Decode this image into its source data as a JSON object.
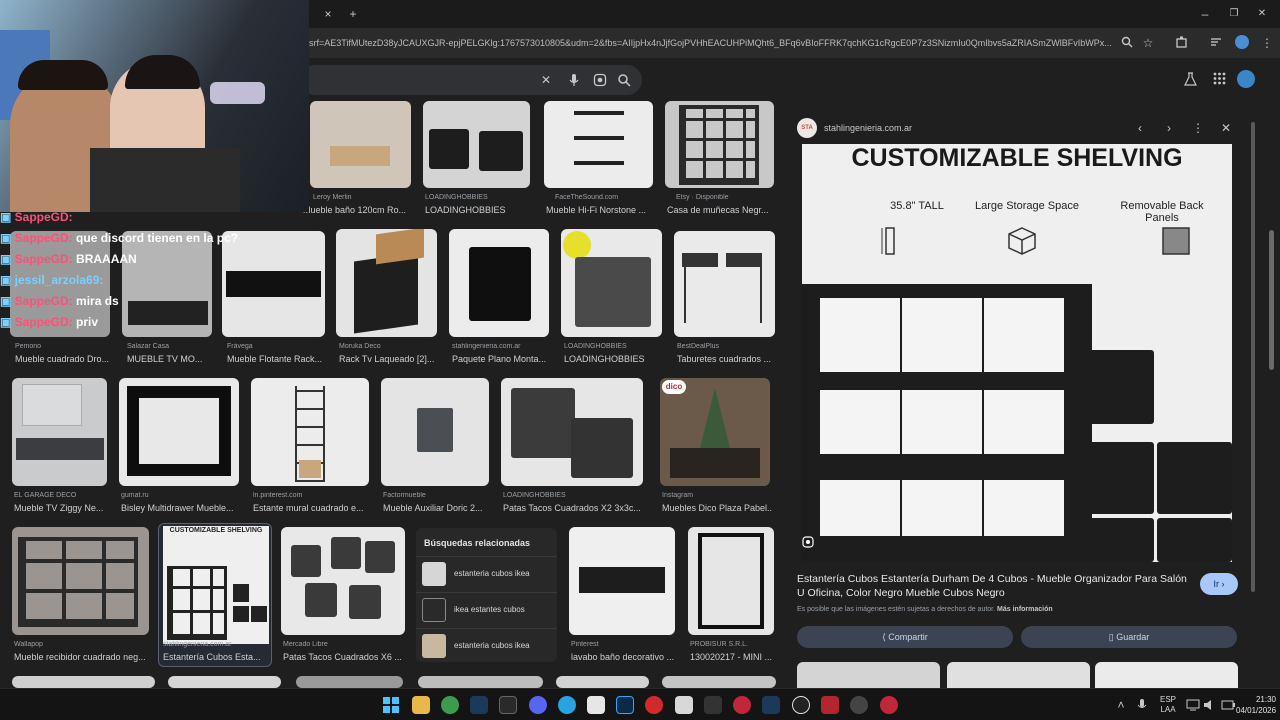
{
  "browser": {
    "url": "sxsrf=AE3TifMUtezD38yJCAUXGJR-epjPELGKlg:1767573010805&udm=2&fbs=AIIjpHx4nJjfGojPVHhEACUHPiMQht6_BFq6vBIoFFRK7qchKG1cRgcE0P7z3SNizmIu0QmIbvs5aZRIASmZWlBFvIbWPx...",
    "tab_close": "×",
    "new_tab": "+",
    "min": "–",
    "max": "❐",
    "close": "✕"
  },
  "search": {
    "clear": "✕"
  },
  "grid": {
    "row1": [
      {
        "src": "Leroy Merlin",
        "title": "Mueble baño 120cm Ro..."
      },
      {
        "src": "LOADINGHOBBIES",
        "title": "LOADINGHOBBIES"
      },
      {
        "src": "FaceTheSound.com",
        "title": "Mueble Hi-Fi Norstone ..."
      },
      {
        "src": "Etsy · Disponible",
        "title": "Casa de muñecas Negr..."
      }
    ],
    "row2": [
      {
        "src": "Pemono",
        "title": "Mueble cuadrado Dro..."
      },
      {
        "src": "Salazar Casa",
        "title": "MUEBLE TV MO..."
      },
      {
        "src": "Frávega",
        "title": "Mueble Flotante Rack..."
      },
      {
        "src": "Moruka Deco",
        "title": "Rack Tv Laqueado [2]..."
      },
      {
        "src": "stahlingenieria.com.ar",
        "title": "Paquete Plano Monta..."
      },
      {
        "src": "LOADINGHOBBIES",
        "title": "LOADINGHOBBIES"
      },
      {
        "src": "BestDealPlus",
        "title": "Taburetes cuadrados ..."
      }
    ],
    "row3": [
      {
        "src": "EL GARAGE DECO",
        "title": "Mueble TV Ziggy Ne..."
      },
      {
        "src": "gumat.ru",
        "title": "Bisley Multidrawer Mueble..."
      },
      {
        "src": "ln.pinterest.com",
        "title": "Estante mural cuadrado e..."
      },
      {
        "src": "Factormueble",
        "title": "Mueble Auxiliar Doric 2..."
      },
      {
        "src": "LOADINGHOBBIES",
        "title": "Patas Tacos Cuadrados X2 3x3c..."
      },
      {
        "src": "Instagram",
        "title": "Muebles Dico Plaza Pabel..."
      }
    ],
    "row4": [
      {
        "src": "Wallapop",
        "title": "Mueble recibidor cuadrado neg..."
      },
      {
        "src": "stahlingenieria.com.ar",
        "title": "Estantería Cubos Esta..."
      },
      {
        "src": "Mercado Libre",
        "title": "Patas Tacos Cuadrados X6 ..."
      },
      {
        "src": "Pinterest",
        "title": "lavabo baño decorativo ..."
      },
      {
        "src": "PROBISUR S.R.L.",
        "title": "130020217 - MINI ..."
      }
    ],
    "dico": "dico",
    "thumb_text": "CUSTOMIZABLE SHELVING"
  },
  "related": {
    "heading": "Búsquedas relacionadas",
    "items": [
      "estanteria cubos ikea",
      "ikea estantes cubos",
      "estanteria cubos ikea"
    ]
  },
  "panel": {
    "site": "stahlingenieria.com.ar",
    "site_logo": "STA",
    "image_heading": "CUSTOMIZABLE SHELVING",
    "features": [
      "35.8\" TALL",
      "Large Storage Space",
      "Removable Back Panels"
    ],
    "title": "Estantería Cubos Estantería Durham De 4 Cubos - Mueble Organizador Para Salón U Oficina, Color Negro Mueble Cubos Negro",
    "visit": "Ir",
    "copyright": "Es posible que las imágenes estén sujetas a derechos de autor.",
    "more_info": "Más información",
    "share": "Compartir",
    "save": "Guardar"
  },
  "chat": [
    {
      "user": "SappeGD:",
      "msg": "",
      "color": "#ff4f7a"
    },
    {
      "user": "SappeGD:",
      "msg": "que discord tienen en la pc?",
      "color": "#ff4f7a"
    },
    {
      "user": "SappeGD:",
      "msg": "BRAAAAN",
      "color": "#ff4f7a"
    },
    {
      "user": "jessil_arzola69:",
      "msg": "",
      "color": "#7ad0ff"
    },
    {
      "user": "SappeGD:",
      "msg": "mira ds",
      "color": "#ff4f7a"
    },
    {
      "user": "SappeGD:",
      "msg": "priv",
      "color": "#ff4f7a"
    }
  ],
  "taskbar": {
    "lang_top": "ESP",
    "lang_bottom": "LAA",
    "time": "21:30",
    "date": "04/01/2026"
  }
}
